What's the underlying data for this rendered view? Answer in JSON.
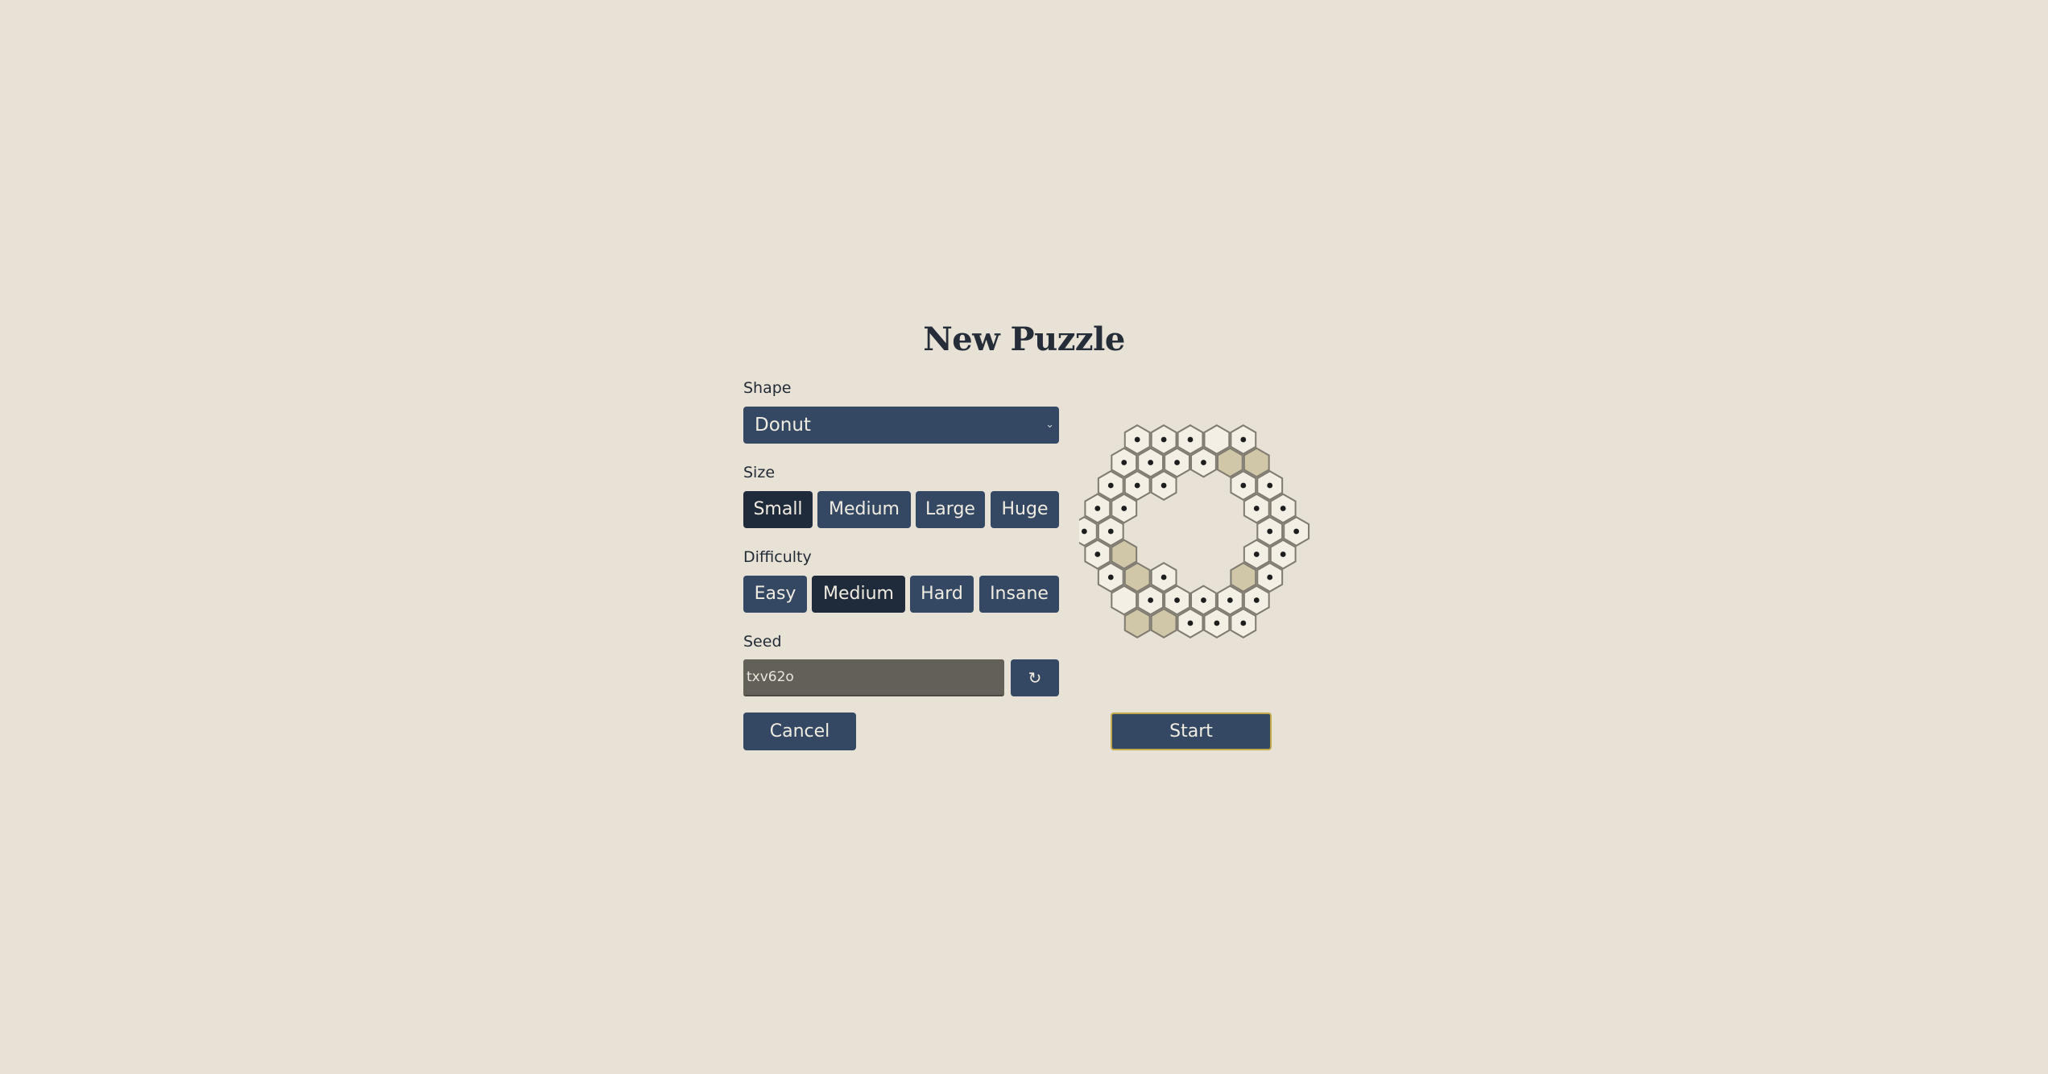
{
  "dialog": {
    "title": "New Puzzle"
  },
  "shape": {
    "label": "Shape",
    "selected": "Donut",
    "chevron": "⌄"
  },
  "size": {
    "label": "Size",
    "options": [
      "Small",
      "Medium",
      "Large",
      "Huge"
    ],
    "selected": "Small"
  },
  "difficulty": {
    "label": "Difficulty",
    "options": [
      "Easy",
      "Medium",
      "Hard",
      "Insane"
    ],
    "selected": "Medium"
  },
  "seed": {
    "label": "Seed",
    "value": "txv62o",
    "refresh_icon": "↻"
  },
  "actions": {
    "cancel_label": "Cancel",
    "start_label": "Start"
  },
  "colors": {
    "background": "#e8e1d5",
    "button": "#344863",
    "button_selected": "#1f2a3a",
    "hex_fill": "#f3efe4",
    "hex_shaded": "#cfc7a8",
    "hex_stroke": "#7f7b70",
    "start_border": "#c2a94a"
  },
  "preview": {
    "shape": "donut",
    "cells": [
      {
        "q": 0,
        "r": -4,
        "dot": true,
        "shaded": false
      },
      {
        "q": 1,
        "r": -4,
        "dot": true,
        "shaded": false
      },
      {
        "q": 2,
        "r": -4,
        "dot": true,
        "shaded": false
      },
      {
        "q": 3,
        "r": -4,
        "dot": false,
        "shaded": false
      },
      {
        "q": 4,
        "r": -4,
        "dot": true,
        "shaded": false
      },
      {
        "q": -1,
        "r": -3,
        "dot": true,
        "shaded": false
      },
      {
        "q": 0,
        "r": -3,
        "dot": true,
        "shaded": false
      },
      {
        "q": 1,
        "r": -3,
        "dot": true,
        "shaded": false
      },
      {
        "q": 2,
        "r": -3,
        "dot": true,
        "shaded": false
      },
      {
        "q": 3,
        "r": -3,
        "dot": false,
        "shaded": true
      },
      {
        "q": 4,
        "r": -3,
        "dot": false,
        "shaded": true
      },
      {
        "q": -2,
        "r": -2,
        "dot": true,
        "shaded": false
      },
      {
        "q": -1,
        "r": -2,
        "dot": true,
        "shaded": false
      },
      {
        "q": 0,
        "r": -2,
        "dot": true,
        "shaded": false
      },
      {
        "q": 3,
        "r": -2,
        "dot": true,
        "shaded": false
      },
      {
        "q": 4,
        "r": -2,
        "dot": true,
        "shaded": false
      },
      {
        "q": -3,
        "r": -1,
        "dot": true,
        "shaded": false
      },
      {
        "q": -2,
        "r": -1,
        "dot": true,
        "shaded": false
      },
      {
        "q": 3,
        "r": -1,
        "dot": true,
        "shaded": false
      },
      {
        "q": 4,
        "r": -1,
        "dot": true,
        "shaded": false
      },
      {
        "q": -4,
        "r": 0,
        "dot": true,
        "shaded": false
      },
      {
        "q": -3,
        "r": 0,
        "dot": true,
        "shaded": false
      },
      {
        "q": 3,
        "r": 0,
        "dot": true,
        "shaded": false
      },
      {
        "q": 4,
        "r": 0,
        "dot": true,
        "shaded": false
      },
      {
        "q": -4,
        "r": 1,
        "dot": true,
        "shaded": false
      },
      {
        "q": -3,
        "r": 1,
        "dot": false,
        "shaded": true
      },
      {
        "q": 2,
        "r": 1,
        "dot": true,
        "shaded": false
      },
      {
        "q": 3,
        "r": 1,
        "dot": true,
        "shaded": false
      },
      {
        "q": -4,
        "r": 2,
        "dot": true,
        "shaded": false
      },
      {
        "q": -3,
        "r": 2,
        "dot": false,
        "shaded": true
      },
      {
        "q": -2,
        "r": 2,
        "dot": true,
        "shaded": false
      },
      {
        "q": 1,
        "r": 2,
        "dot": false,
        "shaded": true
      },
      {
        "q": 2,
        "r": 2,
        "dot": true,
        "shaded": false
      },
      {
        "q": -4,
        "r": 3,
        "dot": false,
        "shaded": false
      },
      {
        "q": -3,
        "r": 3,
        "dot": true,
        "shaded": false
      },
      {
        "q": -2,
        "r": 3,
        "dot": true,
        "shaded": false
      },
      {
        "q": -1,
        "r": 3,
        "dot": true,
        "shaded": false
      },
      {
        "q": 0,
        "r": 3,
        "dot": true,
        "shaded": false
      },
      {
        "q": 1,
        "r": 3,
        "dot": true,
        "shaded": false
      },
      {
        "q": -4,
        "r": 4,
        "dot": false,
        "shaded": true
      },
      {
        "q": -3,
        "r": 4,
        "dot": false,
        "shaded": true
      },
      {
        "q": -2,
        "r": 4,
        "dot": true,
        "shaded": false
      },
      {
        "q": -1,
        "r": 4,
        "dot": true,
        "shaded": false
      },
      {
        "q": 0,
        "r": 4,
        "dot": true,
        "shaded": false
      }
    ]
  }
}
